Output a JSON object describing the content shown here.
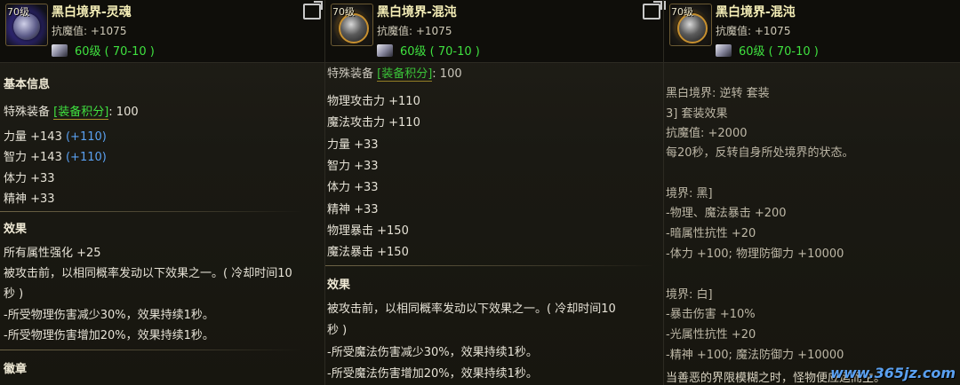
{
  "panels": [
    {
      "level_badge": "70级",
      "title": "黑白境界-灵魂",
      "resist": "抗魔值: +1075",
      "level_text": "60级 ( 70-10 )",
      "lines": [
        {
          "text": "基本信息",
          "kind": "sec"
        },
        {
          "pre": "特殊装备 ",
          "tag": "[装备积分]",
          "post": ": 100"
        },
        {
          "text": "力量 +143 ",
          "blue": "(+110)"
        },
        {
          "text": "智力 +143 ",
          "blue": "(+110)"
        },
        {
          "text": "体力 +33"
        },
        {
          "text": "精神 +33"
        },
        {
          "text": "效果",
          "kind": "sec"
        },
        {
          "text": "所有属性强化 +25"
        },
        {
          "text": "被攻击前，以相同概率发动以下效果之一。( 冷却时间10"
        },
        {
          "text": "秒 )"
        },
        {
          "text": "-所受物理伤害减少30%，效果持续1秒。"
        },
        {
          "text": "-所受物理伤害增加20%，效果持续1秒。"
        },
        {
          "text": "徽章",
          "kind": "sec"
        }
      ]
    },
    {
      "level_badge": "70级",
      "title": "黑白境界-混沌",
      "resist": "抗魔值: +1075",
      "level_text": "60级 ( 70-10 )",
      "lines": [
        {
          "pre": "特殊装备 ",
          "tag": "[装备积分]",
          "post": ": 100"
        },
        {
          "text": "物理攻击力 +110"
        },
        {
          "text": "魔法攻击力 +110"
        },
        {
          "text": "力量 +33"
        },
        {
          "text": "智力 +33"
        },
        {
          "text": "体力 +33"
        },
        {
          "text": "精神 +33"
        },
        {
          "text": "物理暴击 +150"
        },
        {
          "text": "魔法暴击 +150"
        },
        {
          "text": "效果",
          "kind": "sec"
        },
        {
          "text": "被攻击前，以相同概率发动以下效果之一。( 冷却时间10"
        },
        {
          "text": "秒 )"
        },
        {
          "text": "-所受魔法伤害减少30%，效果持续1秒。"
        },
        {
          "text": "-所受魔法伤害增加20%，效果持续1秒。"
        }
      ]
    },
    {
      "level_badge": "70级",
      "title": "黑白境界-混沌",
      "resist": "抗魔值: +1075",
      "level_text": "60级 ( 70-10 )",
      "lines": [
        {
          "text": "黑白境界: 逆转 套装"
        },
        {
          "text": "3] 套装效果"
        },
        {
          "text": "抗魔值: +2000"
        },
        {
          "text": "每20秒，反转自身所处境界的状态。"
        },
        {
          "text": "境界: 黑]"
        },
        {
          "text": "-物理、魔法暴击 +200"
        },
        {
          "text": "-暗属性抗性 +20"
        },
        {
          "text": "-体力 +100; 物理防御力 +10000"
        },
        {
          "text": "境界: 白]"
        },
        {
          "text": "-暴击伤害 +10%"
        },
        {
          "text": "-光属性抗性 +20"
        },
        {
          "text": "-精神 +100; 魔法防御力 +10000"
        },
        {
          "text": "当善恶的界限模糊之时，怪物便应运而生。"
        }
      ]
    }
  ],
  "watermark": "www.365jz.com",
  "colors": {
    "green": "#3fe03f",
    "blue": "#5aa0f0",
    "title": "#f6efb8"
  }
}
